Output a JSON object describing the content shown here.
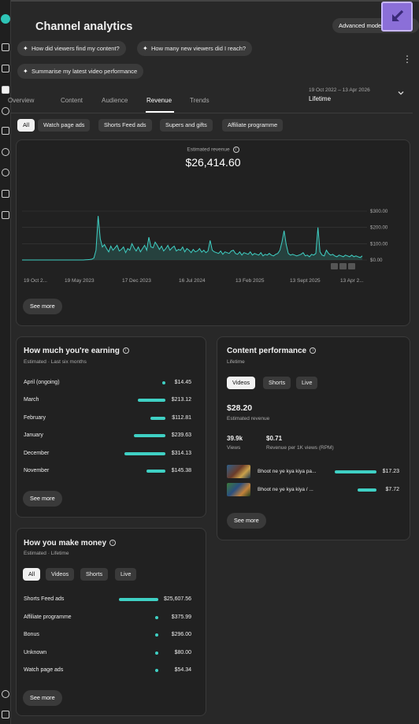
{
  "header": {
    "title": "Channel analytics",
    "advanced_mode_label": "Advanced mode",
    "close_icon": "arrow-down-left-icon"
  },
  "suggestions": [
    "How did viewers find my content?",
    "How many new viewers did I reach?",
    "Summarise my latest video performance"
  ],
  "tabs": [
    "Overview",
    "Content",
    "Audience",
    "Revenue",
    "Trends"
  ],
  "active_tab": "Revenue",
  "date": {
    "range": "19 Oct 2022 – 13 Apr 2026",
    "label": "Lifetime"
  },
  "filters": [
    "All",
    "Watch page ads",
    "Shorts Feed ads",
    "Supers and gifts",
    "Affiliate programme"
  ],
  "revenue_card": {
    "label": "Estimated revenue",
    "value": "$26,414.60",
    "see_more": "See more"
  },
  "chart_data": {
    "type": "area",
    "x_tick_labels": [
      "19 Oct 2...",
      "19 May 2023",
      "17 Dec 2023",
      "16 Jul 2024",
      "13 Feb 2025",
      "13 Sept 2025",
      "13 Apr 2..."
    ],
    "y_tick_labels": [
      "$300.00",
      "$200.00",
      "$100.00",
      "$0.00"
    ],
    "ylim": [
      0,
      300
    ],
    "series_color": "#3fd0c4",
    "values": [
      0,
      0,
      0,
      0,
      0,
      0,
      0,
      0,
      0,
      0,
      0,
      0,
      0,
      0,
      0,
      0,
      0,
      0,
      0,
      0,
      0,
      0,
      0,
      0,
      0,
      0,
      0,
      0,
      0,
      0,
      1,
      2,
      3,
      5,
      12,
      60,
      270,
      130,
      80,
      95,
      70,
      50,
      85,
      60,
      75,
      90,
      55,
      65,
      80,
      45,
      70,
      60,
      100,
      75,
      55,
      80,
      50,
      70,
      90,
      60,
      140,
      80,
      75,
      110,
      90,
      65,
      85,
      55,
      70,
      90,
      60,
      75,
      85,
      55,
      65,
      60,
      80,
      50,
      70,
      60,
      45,
      65,
      50,
      55,
      70,
      48,
      60,
      45,
      55,
      120,
      60,
      50,
      45,
      40,
      55,
      35,
      50,
      45,
      40,
      55,
      60,
      40,
      35,
      50,
      30,
      45,
      40,
      35,
      50,
      30,
      40,
      35,
      30,
      45,
      25,
      35,
      30,
      40,
      30,
      25,
      35,
      40,
      60,
      110,
      180,
      95,
      40,
      30,
      35,
      30,
      25,
      30,
      35,
      45,
      25,
      30,
      20,
      35,
      30,
      40,
      200,
      50,
      30,
      25,
      60,
      40,
      30,
      35,
      25,
      20,
      30,
      25,
      20,
      30,
      25,
      20,
      30,
      20,
      25,
      20,
      15,
      25
    ]
  },
  "earning_card": {
    "title": "How much you're earning",
    "subtitle": "Estimated · Last six months",
    "rows": [
      {
        "label": "April (ongoing)",
        "value": "$14.45",
        "amount": 14.45
      },
      {
        "label": "March",
        "value": "$213.12",
        "amount": 213.12
      },
      {
        "label": "February",
        "value": "$112.81",
        "amount": 112.81
      },
      {
        "label": "January",
        "value": "$239.63",
        "amount": 239.63
      },
      {
        "label": "December",
        "value": "$314.13",
        "amount": 314.13
      },
      {
        "label": "November",
        "value": "$145.38",
        "amount": 145.38
      }
    ],
    "see_more": "See more"
  },
  "content_card": {
    "title": "Content performance",
    "subtitle": "Lifetime",
    "segments": [
      "Videos",
      "Shorts",
      "Live"
    ],
    "active_segment": "Videos",
    "revenue_value": "$28.20",
    "revenue_label": "Estimated revenue",
    "views_value": "39.9k",
    "views_label": "Views",
    "rpm_value": "$0.71",
    "rpm_label": "Revenue per 1K views (RPM)",
    "videos": [
      {
        "title": "Bhoot ne ye kya kiya pa...",
        "value": "$17.23",
        "amount": 17.23
      },
      {
        "title": "Bhoot ne ye kya kiya / ...",
        "value": "$7.72",
        "amount": 7.72
      }
    ],
    "see_more": "See more"
  },
  "money_card": {
    "title": "How you make money",
    "subtitle": "Estimated · Lifetime",
    "segments": [
      "All",
      "Videos",
      "Shorts",
      "Live"
    ],
    "active_segment": "All",
    "rows": [
      {
        "label": "Shorts Feed ads",
        "value": "$25,607.56",
        "amount": 25607.56
      },
      {
        "label": "Affiliate programme",
        "value": "$375.99",
        "amount": 375.99
      },
      {
        "label": "Bonus",
        "value": "$296.00",
        "amount": 296.0
      },
      {
        "label": "Unknown",
        "value": "$80.00",
        "amount": 80.0
      },
      {
        "label": "Watch page ads",
        "value": "$54.34",
        "amount": 54.34
      }
    ],
    "see_more": "See more"
  }
}
